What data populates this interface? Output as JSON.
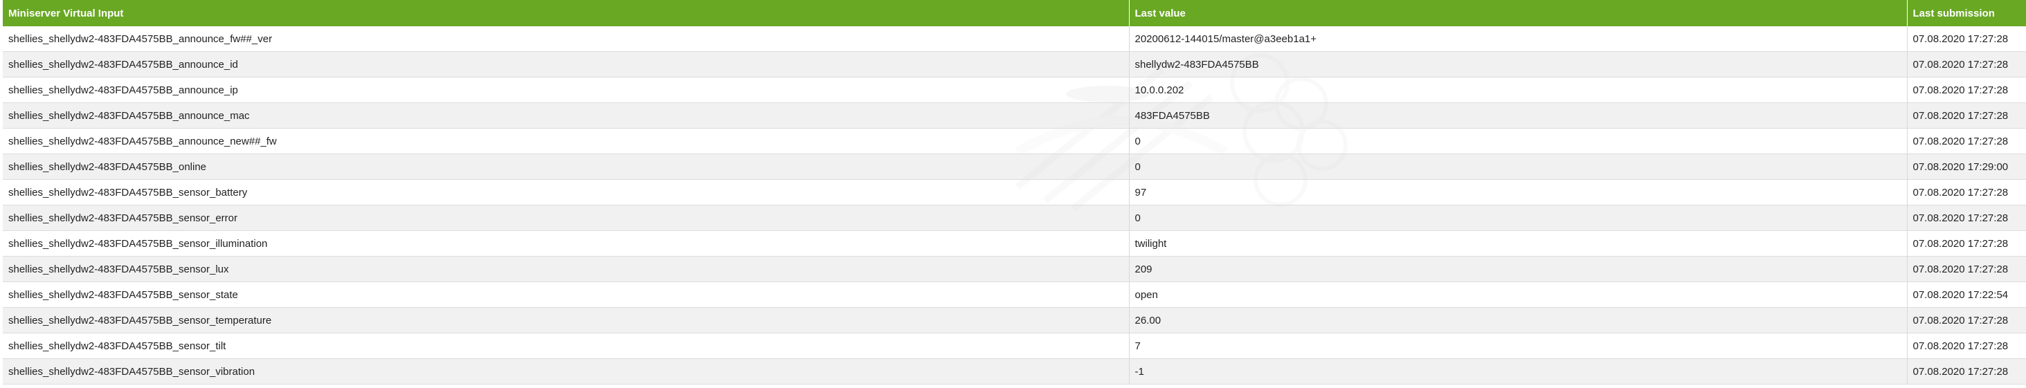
{
  "table": {
    "headers": [
      "Miniserver Virtual Input",
      "Last value",
      "Last submission"
    ],
    "rows": [
      {
        "input": "shellies_shellydw2-483FDA4575BB_announce_fw##_ver",
        "value": "20200612-144015/master@a3eeb1a1+",
        "submitted": "07.08.2020 17:27:28"
      },
      {
        "input": "shellies_shellydw2-483FDA4575BB_announce_id",
        "value": "shellydw2-483FDA4575BB",
        "submitted": "07.08.2020 17:27:28"
      },
      {
        "input": "shellies_shellydw2-483FDA4575BB_announce_ip",
        "value": "10.0.0.202",
        "submitted": "07.08.2020 17:27:28"
      },
      {
        "input": "shellies_shellydw2-483FDA4575BB_announce_mac",
        "value": "483FDA4575BB",
        "submitted": "07.08.2020 17:27:28"
      },
      {
        "input": "shellies_shellydw2-483FDA4575BB_announce_new##_fw",
        "value": "0",
        "submitted": "07.08.2020 17:27:28"
      },
      {
        "input": "shellies_shellydw2-483FDA4575BB_online",
        "value": "0",
        "submitted": "07.08.2020 17:29:00"
      },
      {
        "input": "shellies_shellydw2-483FDA4575BB_sensor_battery",
        "value": "97",
        "submitted": "07.08.2020 17:27:28"
      },
      {
        "input": "shellies_shellydw2-483FDA4575BB_sensor_error",
        "value": "0",
        "submitted": "07.08.2020 17:27:28"
      },
      {
        "input": "shellies_shellydw2-483FDA4575BB_sensor_illumination",
        "value": "twilight",
        "submitted": "07.08.2020 17:27:28"
      },
      {
        "input": "shellies_shellydw2-483FDA4575BB_sensor_lux",
        "value": "209",
        "submitted": "07.08.2020 17:27:28"
      },
      {
        "input": "shellies_shellydw2-483FDA4575BB_sensor_state",
        "value": "open",
        "submitted": "07.08.2020 17:22:54"
      },
      {
        "input": "shellies_shellydw2-483FDA4575BB_sensor_temperature",
        "value": "26.00",
        "submitted": "07.08.2020 17:27:28"
      },
      {
        "input": "shellies_shellydw2-483FDA4575BB_sensor_tilt",
        "value": "7",
        "submitted": "07.08.2020 17:27:28"
      },
      {
        "input": "shellies_shellydw2-483FDA4575BB_sensor_vibration",
        "value": "-1",
        "submitted": "07.08.2020 17:27:28"
      }
    ]
  },
  "colors": {
    "header_bg": "#69a823",
    "header_text": "#ffffff",
    "row_alt": "#ececec"
  },
  "watermark": {
    "icon": "logo-watermark-icon"
  }
}
